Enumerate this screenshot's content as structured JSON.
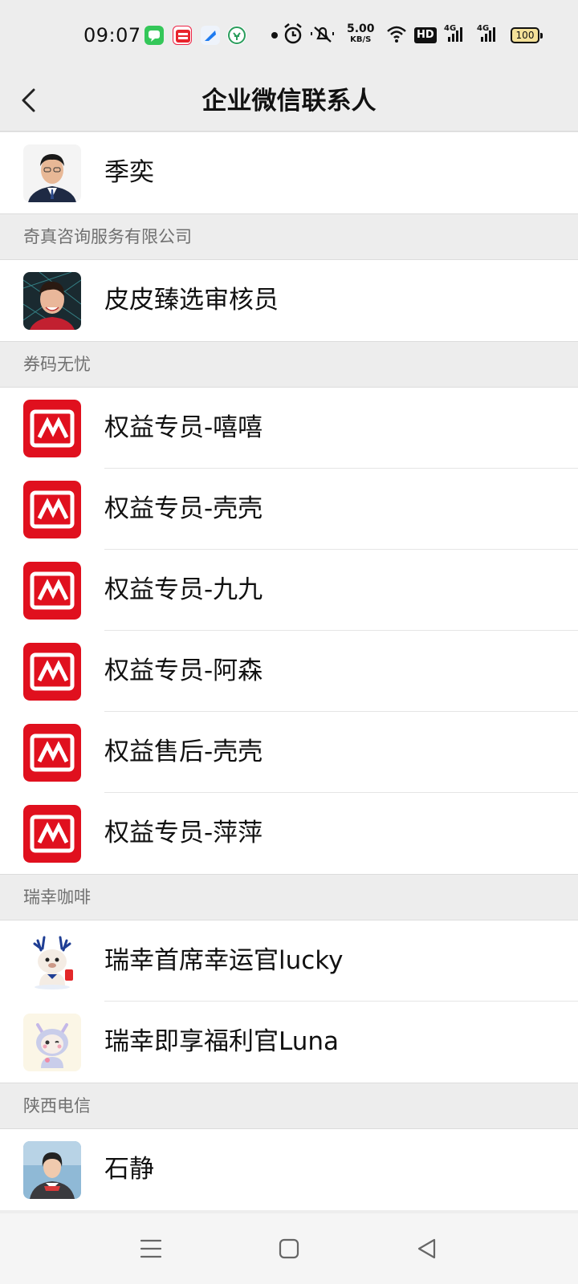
{
  "status_bar": {
    "time": "09:07",
    "speed_value": "5.00",
    "speed_unit": "KB/S",
    "hd_label": "HD",
    "network_1": "4G",
    "network_2": "4G",
    "battery": "100"
  },
  "header": {
    "title": "企业微信联系人",
    "back_icon": "chevron-left-icon"
  },
  "contacts": {
    "top": [
      {
        "name": "季奕"
      }
    ],
    "groups": [
      {
        "title": "奇真咨询服务有限公司",
        "items": [
          {
            "name": "皮皮臻选审核员"
          }
        ]
      },
      {
        "title": "券码无忧",
        "items": [
          {
            "name": "权益专员-嘻嘻"
          },
          {
            "name": "权益专员-壳壳"
          },
          {
            "name": "权益专员-九九"
          },
          {
            "name": "权益专员-阿森"
          },
          {
            "name": "权益售后-壳壳"
          },
          {
            "name": "权益专员-萍萍"
          }
        ]
      },
      {
        "title": "瑞幸咖啡",
        "items": [
          {
            "name": "瑞幸首席幸运官lucky"
          },
          {
            "name": "瑞幸即享福利官Luna"
          }
        ]
      },
      {
        "title": "陕西电信",
        "items": [
          {
            "name": "石静"
          }
        ]
      }
    ]
  },
  "colors": {
    "brand_red": "#e0101e",
    "background": "#ededed",
    "section_text": "#707070"
  },
  "nav": {
    "menu_icon": "menu-icon",
    "home_icon": "square-home-icon",
    "back_icon": "triangle-back-icon"
  }
}
